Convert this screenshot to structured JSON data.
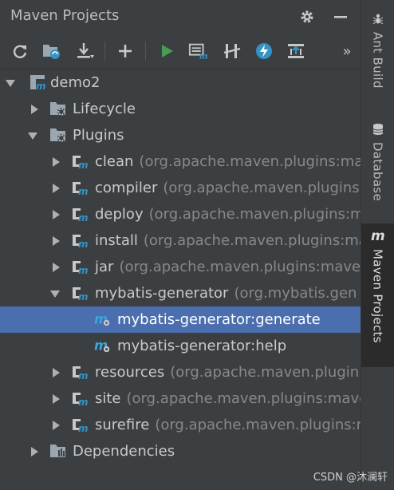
{
  "panel": {
    "title": "Maven Projects",
    "title_icons": [
      "gear-icon",
      "minimize-icon"
    ]
  },
  "toolbar": {
    "buttons": [
      {
        "name": "reimport-icon"
      },
      {
        "name": "generate-sources-icon"
      },
      {
        "name": "download-icon"
      },
      {
        "name": "add-icon"
      },
      {
        "name": "run-icon"
      },
      {
        "name": "execute-goal-icon"
      },
      {
        "name": "toggle-offline-icon"
      },
      {
        "name": "skip-tests-icon"
      },
      {
        "name": "show-dependencies-icon"
      }
    ],
    "more": "»"
  },
  "tree": {
    "root": {
      "label": "demo2",
      "expanded": true
    },
    "lifecycle": {
      "label": "Lifecycle",
      "expanded": false
    },
    "plugins": {
      "label": "Plugins",
      "expanded": true
    },
    "plugin_items": [
      {
        "label": "clean",
        "hint": "(org.apache.maven.plugins:ma",
        "expanded": false
      },
      {
        "label": "compiler",
        "hint": "(org.apache.maven.plugins",
        "expanded": false
      },
      {
        "label": "deploy",
        "hint": "(org.apache.maven.plugins:m",
        "expanded": false
      },
      {
        "label": "install",
        "hint": "(org.apache.maven.plugins:ma",
        "expanded": false
      },
      {
        "label": "jar",
        "hint": "(org.apache.maven.plugins:maven",
        "expanded": false
      },
      {
        "label": "mybatis-generator",
        "hint": "(org.mybatis.gen",
        "expanded": true
      }
    ],
    "goals": [
      {
        "label": "mybatis-generator:generate",
        "selected": true
      },
      {
        "label": "mybatis-generator:help",
        "selected": false
      }
    ],
    "plugin_items_after": [
      {
        "label": "resources",
        "hint": "(org.apache.maven.plugin",
        "expanded": false
      },
      {
        "label": "site",
        "hint": "(org.apache.maven.plugins:mave",
        "expanded": false
      },
      {
        "label": "surefire",
        "hint": "(org.apache.maven.plugins:r",
        "expanded": false
      }
    ],
    "dependencies": {
      "label": "Dependencies",
      "expanded": false
    }
  },
  "side_tabs": [
    {
      "label": "Ant Build",
      "icon": "ant-icon",
      "active": false
    },
    {
      "label": "Database",
      "icon": "database-icon",
      "active": false
    },
    {
      "label": "Maven Projects",
      "icon": "maven-icon",
      "active": true
    }
  ],
  "watermark": "CSDN @沐澜轩",
  "colors": {
    "background": "#3c3f41",
    "selection": "#4b6eaf",
    "run_green": "#499c54",
    "accent_blue": "#3592c4"
  }
}
